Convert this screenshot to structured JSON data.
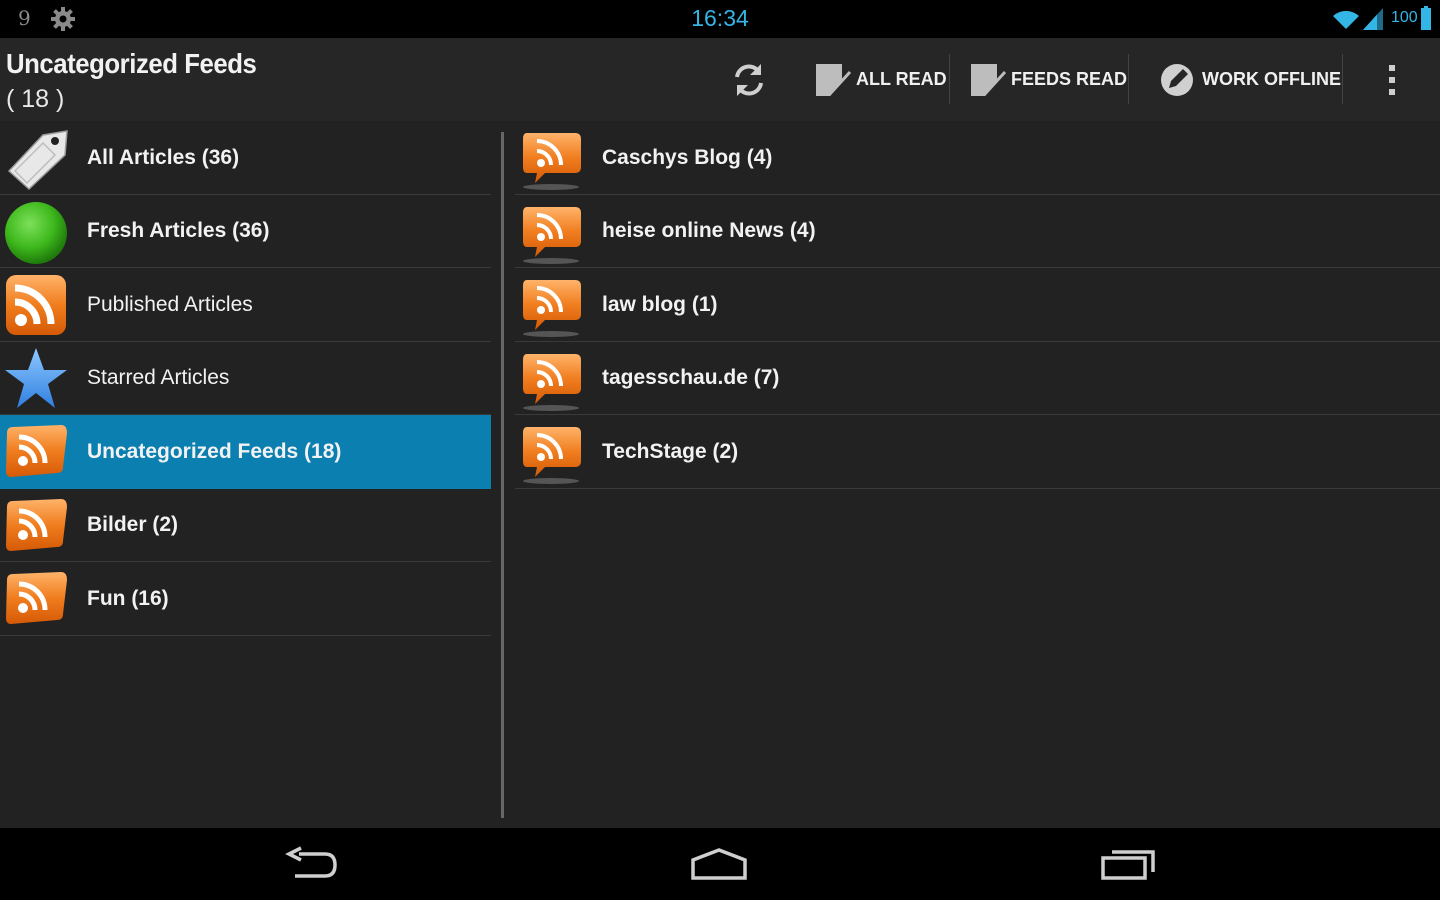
{
  "status_bar": {
    "notification_count": "9",
    "time": "16:34",
    "battery": "100"
  },
  "action_bar": {
    "title": "Uncategorized Feeds",
    "subtitle": "( 18 )",
    "refresh_icon": "refresh-icon",
    "buttons": {
      "all_read": "ALL READ",
      "feeds_read": "FEEDS READ",
      "work_offline": "WORK OFFLINE"
    },
    "overflow_icon": "overflow-menu-icon"
  },
  "categories": [
    {
      "label": "All Articles (36)",
      "icon": "tag-icon",
      "bold": true
    },
    {
      "label": "Fresh Articles (36)",
      "icon": "green-circle-icon",
      "bold": true
    },
    {
      "label": "Published Articles",
      "icon": "rss-square-icon",
      "bold": false
    },
    {
      "label": "Starred Articles",
      "icon": "star-icon",
      "bold": false
    },
    {
      "label": "Uncategorized Feeds (18)",
      "icon": "rss-bubble-icon",
      "bold": true,
      "selected": true
    },
    {
      "label": "Bilder (2)",
      "icon": "rss-bubble-icon",
      "bold": true
    },
    {
      "label": "Fun (16)",
      "icon": "rss-bubble-icon",
      "bold": true
    }
  ],
  "feeds": [
    {
      "label": "Caschys Blog (4)",
      "icon": "feed-icon"
    },
    {
      "label": "heise online News (4)",
      "icon": "feed-icon"
    },
    {
      "label": "law blog (1)",
      "icon": "feed-icon"
    },
    {
      "label": "tagesschau.de (7)",
      "icon": "feed-icon"
    },
    {
      "label": "TechStage (2)",
      "icon": "feed-icon"
    }
  ],
  "nav_bar": {
    "back_icon": "back-icon",
    "home_icon": "home-icon",
    "recents_icon": "recent-apps-icon"
  },
  "colors": {
    "selected_row": "#0a7fb0",
    "accent": "#33b5e5",
    "rss_orange": "#f07d1e"
  }
}
